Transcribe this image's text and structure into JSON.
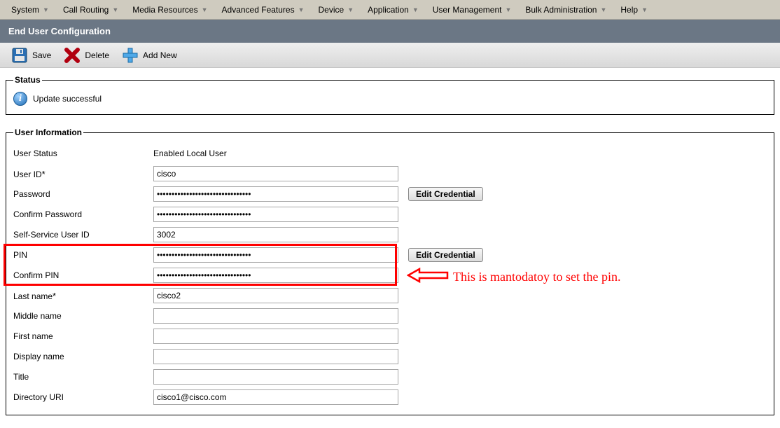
{
  "menu": {
    "system": "System",
    "call_routing": "Call Routing",
    "media_resources": "Media Resources",
    "advanced_features": "Advanced Features",
    "device": "Device",
    "application": "Application",
    "user_management": "User Management",
    "bulk_administration": "Bulk Administration",
    "help": "Help"
  },
  "titlebar": "End User Configuration",
  "toolbar": {
    "save": "Save",
    "delete": "Delete",
    "add_new": "Add New"
  },
  "status": {
    "legend": "Status",
    "message": "Update successful"
  },
  "user_info": {
    "legend": "User Information",
    "labels": {
      "user_status": "User Status",
      "user_id": "User ID",
      "password": "Password",
      "confirm_password": "Confirm Password",
      "self_service_user_id": "Self-Service User ID",
      "pin": "PIN",
      "confirm_pin": "Confirm PIN",
      "last_name": "Last name",
      "middle_name": "Middle name",
      "first_name": "First name",
      "display_name": "Display name",
      "title": "Title",
      "directory_uri": "Directory URI"
    },
    "values": {
      "user_status": "Enabled Local User",
      "user_id": "cisco",
      "password": "●●●●●●●●●●●●●●●●●●●●●●●●●●●●●●●●",
      "confirm_password": "●●●●●●●●●●●●●●●●●●●●●●●●●●●●●●●●",
      "self_service_user_id": "3002",
      "pin": "●●●●●●●●●●●●●●●●●●●●●●●●●●●●●●●●",
      "confirm_pin": "●●●●●●●●●●●●●●●●●●●●●●●●●●●●●●●●",
      "last_name": "cisco2",
      "middle_name": "",
      "first_name": "",
      "display_name": "",
      "title": "",
      "directory_uri": "cisco1@cisco.com"
    },
    "edit_credential": "Edit Credential"
  },
  "annotation": "This is mantodatoy to set the pin."
}
